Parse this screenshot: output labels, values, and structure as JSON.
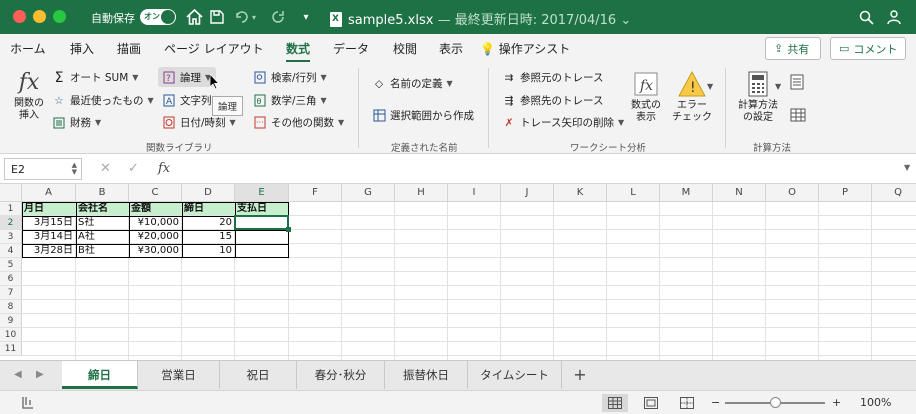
{
  "titlebar": {
    "autosave_label": "自動保存",
    "autosave_state": "オン",
    "doc_name": "sample5.xlsx",
    "separator": " — ",
    "last_modified": "最終更新日時: 2017/04/16",
    "dropdown": "⌄"
  },
  "tabs": [
    "ホーム",
    "挿入",
    "描画",
    "ページ レイアウト",
    "数式",
    "データ",
    "校閲",
    "表示",
    "操作アシスト"
  ],
  "active_tab": "数式",
  "share_label": "共有",
  "comment_label": "コメント",
  "ribbon": {
    "insert_function": "関数の\n挿入",
    "fx": "fx",
    "autosum": "オート SUM",
    "recent": "最近使ったもの",
    "financial": "財務",
    "logical": "論理",
    "text": "文字列",
    "datetime": "日付/時刻",
    "lookup": "検索/行列",
    "math": "数学/三角",
    "more": "その他の関数",
    "group_library": "関数ライブラリ",
    "name_define": "名前の定義",
    "create_from_sel": "選択範囲から作成",
    "group_names": "定義された名前",
    "trace_precedents": "参照元のトレース",
    "trace_dependents": "参照先のトレース",
    "remove_arrows": "トレース矢印の削除",
    "show_formulas": "数式の\n表示",
    "error_check": "エラー\nチェック",
    "group_audit": "ワークシート分析",
    "calc_options": "計算方法\nの設定",
    "group_calc": "計算方法",
    "tooltip": "論理"
  },
  "formula_bar": {
    "name_box": "E2",
    "fx": "fx",
    "cancel": "✕",
    "enter": "✓",
    "value": ""
  },
  "columns": [
    "A",
    "B",
    "C",
    "D",
    "E",
    "F",
    "G",
    "H",
    "I",
    "J",
    "K",
    "L",
    "M",
    "N",
    "O",
    "P",
    "Q"
  ],
  "rows": [
    "1",
    "2",
    "3",
    "4",
    "5",
    "6",
    "7",
    "8",
    "9",
    "10",
    "11"
  ],
  "table": {
    "headers": [
      "月日",
      "会社名",
      "金額",
      "締日",
      "支払日"
    ],
    "rows": [
      [
        "3月15日",
        "S社",
        "¥10,000",
        "20",
        ""
      ],
      [
        "3月14日",
        "A社",
        "¥20,000",
        "15",
        ""
      ],
      [
        "3月28日",
        "B社",
        "¥30,000",
        "10",
        ""
      ]
    ]
  },
  "sheets": [
    "締日",
    "営業日",
    "祝日",
    "春分･秋分",
    "振替休日",
    "タイムシート"
  ],
  "active_sheet": "締日",
  "add_sheet": "+",
  "status": {
    "zoom_minus": "−",
    "zoom_plus": "+",
    "zoom": "100%",
    "zoom_fraction": 0.5
  },
  "colors": {
    "brand": "#1e7145",
    "header_fill": "#c6efce"
  }
}
